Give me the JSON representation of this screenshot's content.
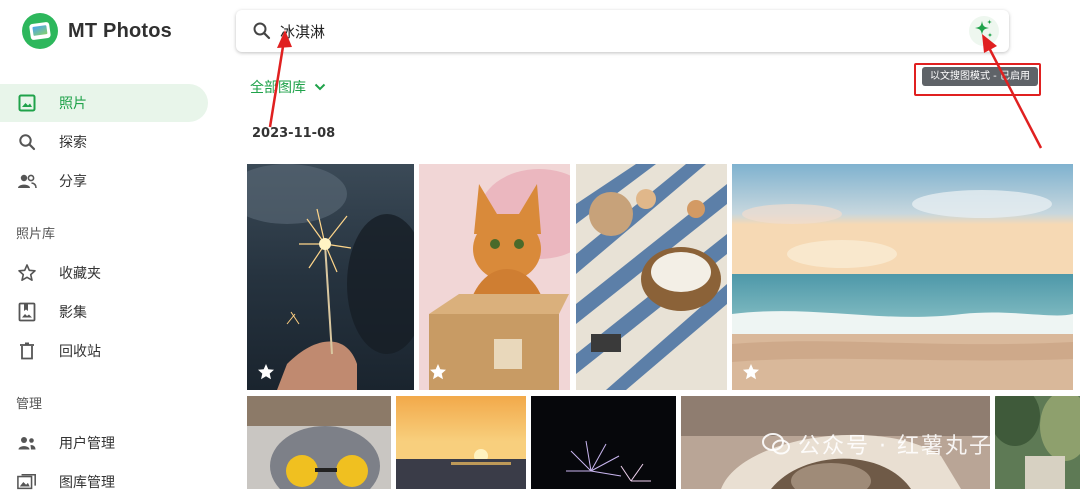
{
  "app": {
    "name": "MT Photos"
  },
  "sidebar": {
    "primary": [
      {
        "label": "照片",
        "icon": "photo-icon",
        "active": true
      },
      {
        "label": "探索",
        "icon": "search-icon",
        "active": false
      },
      {
        "label": "分享",
        "icon": "people-icon",
        "active": false
      }
    ],
    "library_section": "照片库",
    "library": [
      {
        "label": "收藏夹",
        "icon": "star-icon"
      },
      {
        "label": "影集",
        "icon": "album-icon"
      },
      {
        "label": "回收站",
        "icon": "trash-icon"
      }
    ],
    "manage_section": "管理",
    "manage": [
      {
        "label": "用户管理",
        "icon": "user-manage-icon"
      },
      {
        "label": "图库管理",
        "icon": "gallery-manage-icon"
      }
    ]
  },
  "search": {
    "value": "冰淇淋",
    "placeholder": ""
  },
  "ai_search": {
    "tooltip": "以文搜图模式 - 已启用",
    "icon": "sparkle-icon",
    "accent": "#1fa24a"
  },
  "filter": {
    "library": "全部图库"
  },
  "date_group": "2023-11-08",
  "photos": [
    {
      "name": "sparkler",
      "favorite_icon": "star-outline-icon"
    },
    {
      "name": "cat-in-box",
      "favorite_icon": "star-outline-icon"
    },
    {
      "name": "picnic",
      "favorite_icon": "star-outline-icon"
    },
    {
      "name": "beach-sunset",
      "favorite_icon": "star-outline-icon"
    },
    {
      "name": "cat-sunglasses"
    },
    {
      "name": "ocean-sunset"
    },
    {
      "name": "fireworks"
    },
    {
      "name": "cat-under-pillow"
    },
    {
      "name": "forest-picnic"
    }
  ],
  "watermark": {
    "text": "公众号 · 红薯丸子"
  },
  "colors": {
    "brand": "#2db75c",
    "active_bg": "#e8f5ea",
    "annotation": "#e02020"
  }
}
